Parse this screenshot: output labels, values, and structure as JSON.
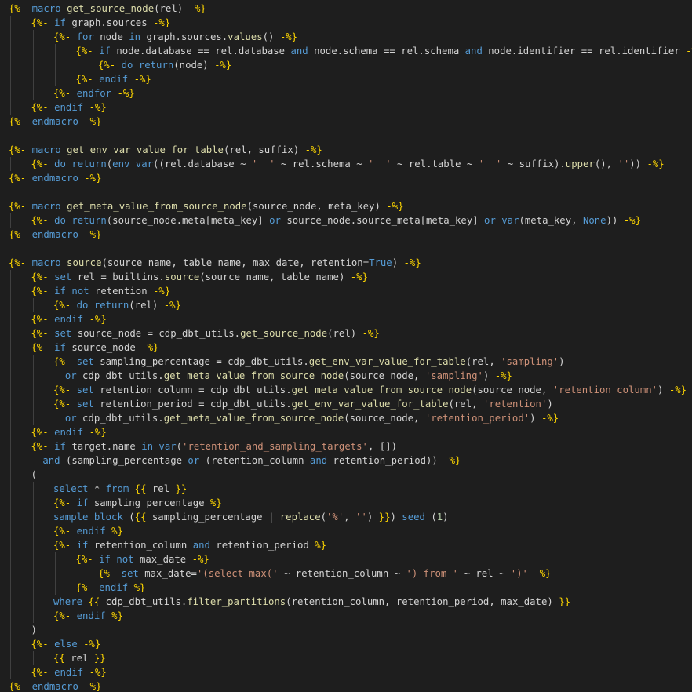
{
  "editor": {
    "language": "jinja-sql",
    "theme": "dark",
    "colors": {
      "background": "#1e1e1e",
      "default": "#d4d4d4",
      "delimiter": "#ffd700",
      "keyword": "#569cd6",
      "function": "#dcdcaa",
      "string": "#ce9178",
      "number": "#b5cea8",
      "indent_guide": "#404040"
    },
    "lines": [
      {
        "indent": 0,
        "text": "{%- macro get_source_node(rel) -%}"
      },
      {
        "indent": 1,
        "text": "{%- if graph.sources -%}"
      },
      {
        "indent": 2,
        "text": "{%- for node in graph.sources.values() -%}"
      },
      {
        "indent": 3,
        "text": "{%- if node.database == rel.database and node.schema == rel.schema and node.identifier == rel.identifier -%}"
      },
      {
        "indent": 4,
        "text": "{%- do return(node) -%}"
      },
      {
        "indent": 3,
        "text": "{%- endif -%}"
      },
      {
        "indent": 2,
        "text": "{%- endfor -%}"
      },
      {
        "indent": 1,
        "text": "{%- endif -%}"
      },
      {
        "indent": 0,
        "text": "{%- endmacro -%}"
      },
      {
        "indent": 0,
        "text": ""
      },
      {
        "indent": 0,
        "text": "{%- macro get_env_var_value_for_table(rel, suffix) -%}"
      },
      {
        "indent": 1,
        "text": "{%- do return(env_var((rel.database ~ '__' ~ rel.schema ~ '__' ~ rel.table ~ '__' ~ suffix).upper(), '')) -%}"
      },
      {
        "indent": 0,
        "text": "{%- endmacro -%}"
      },
      {
        "indent": 0,
        "text": ""
      },
      {
        "indent": 0,
        "text": "{%- macro get_meta_value_from_source_node(source_node, meta_key) -%}"
      },
      {
        "indent": 1,
        "text": "{%- do return(source_node.meta[meta_key] or source_node.source_meta[meta_key] or var(meta_key, None)) -%}"
      },
      {
        "indent": 0,
        "text": "{%- endmacro -%}"
      },
      {
        "indent": 0,
        "text": ""
      },
      {
        "indent": 0,
        "text": "{%- macro source(source_name, table_name, max_date, retention=True) -%}"
      },
      {
        "indent": 1,
        "text": "{%- set rel = builtins.source(source_name, table_name) -%}"
      },
      {
        "indent": 1,
        "text": "{%- if not retention -%}"
      },
      {
        "indent": 2,
        "text": "{%- do return(rel) -%}"
      },
      {
        "indent": 1,
        "text": "{%- endif -%}"
      },
      {
        "indent": 1,
        "text": "{%- set source_node = cdp_dbt_utils.get_source_node(rel) -%}"
      },
      {
        "indent": 1,
        "text": "{%- if source_node -%}"
      },
      {
        "indent": 2,
        "text": "{%- set sampling_percentage = cdp_dbt_utils.get_env_var_value_for_table(rel, 'sampling')"
      },
      {
        "indent": 2,
        "text": "  or cdp_dbt_utils.get_meta_value_from_source_node(source_node, 'sampling') -%}"
      },
      {
        "indent": 2,
        "text": "{%- set retention_column = cdp_dbt_utils.get_meta_value_from_source_node(source_node, 'retention_column') -%}"
      },
      {
        "indent": 2,
        "text": "{%- set retention_period = cdp_dbt_utils.get_env_var_value_for_table(rel, 'retention')"
      },
      {
        "indent": 2,
        "text": "  or cdp_dbt_utils.get_meta_value_from_source_node(source_node, 'retention_period') -%}"
      },
      {
        "indent": 1,
        "text": "{%- endif -%}"
      },
      {
        "indent": 1,
        "text": "{%- if target.name in var('retention_and_sampling_targets', [])"
      },
      {
        "indent": 1,
        "text": "  and (sampling_percentage or (retention_column and retention_period)) -%}"
      },
      {
        "indent": 1,
        "text": "("
      },
      {
        "indent": 2,
        "text": "select * from {{ rel }}"
      },
      {
        "indent": 2,
        "text": "{%- if sampling_percentage %}"
      },
      {
        "indent": 2,
        "text": "sample block ({{ sampling_percentage | replace('%', '') }}) seed (1)"
      },
      {
        "indent": 2,
        "text": "{%- endif %}"
      },
      {
        "indent": 2,
        "text": "{%- if retention_column and retention_period %}"
      },
      {
        "indent": 3,
        "text": "{%- if not max_date -%}"
      },
      {
        "indent": 4,
        "text": "{%- set max_date='(select max(' ~ retention_column ~ ') from ' ~ rel ~ ')' -%}"
      },
      {
        "indent": 3,
        "text": "{%- endif %}"
      },
      {
        "indent": 2,
        "text": "where {{ cdp_dbt_utils.filter_partitions(retention_column, retention_period, max_date) }}"
      },
      {
        "indent": 2,
        "text": "{%- endif %}"
      },
      {
        "indent": 1,
        "text": ")"
      },
      {
        "indent": 1,
        "text": "{%- else -%}"
      },
      {
        "indent": 2,
        "text": "{{ rel }}"
      },
      {
        "indent": 1,
        "text": "{%- endif -%}"
      },
      {
        "indent": 0,
        "text": "{%- endmacro -%}"
      }
    ]
  }
}
